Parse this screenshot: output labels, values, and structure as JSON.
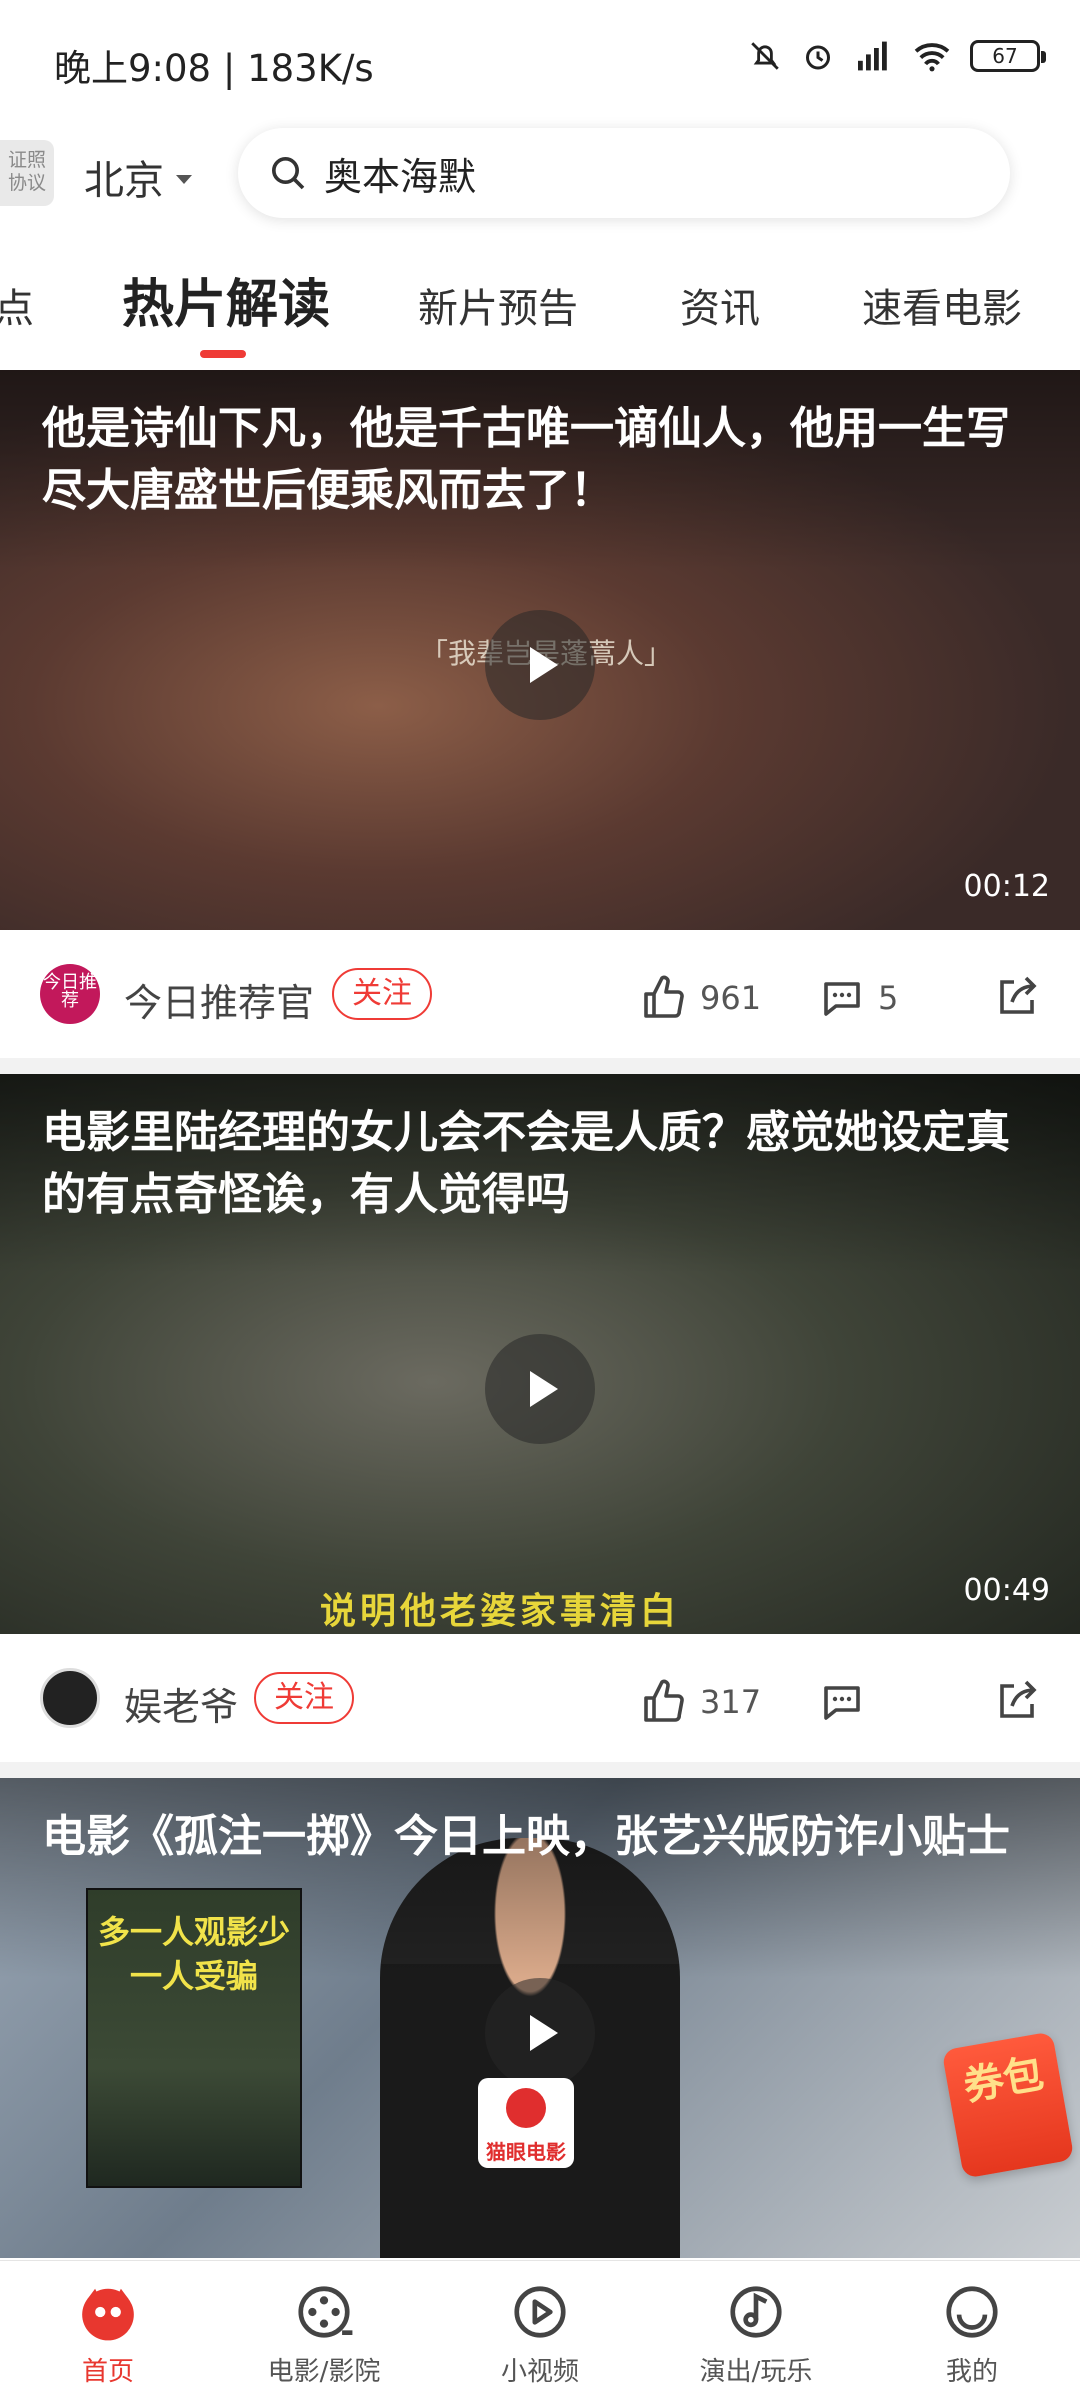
{
  "status_bar": {
    "time": "晚上9:08 | 183K/s",
    "battery": "67"
  },
  "header": {
    "license_badge": "证照协议",
    "city": "北京",
    "search_text": "奥本海默"
  },
  "tabs": [
    {
      "label": "点",
      "active": false
    },
    {
      "label": "热片解读",
      "active": true
    },
    {
      "label": "新片预告",
      "active": false
    },
    {
      "label": "资讯",
      "active": false
    },
    {
      "label": "速看电影",
      "active": false
    }
  ],
  "feed": [
    {
      "title": "他是诗仙下凡，他是千古唯一谪仙人，他用一生写尽大唐盛世后便乘风而去了！",
      "overlay_text": "「我辈岂是蓬蒿人」",
      "duration": "00:12",
      "author": "今日推荐官",
      "author_avatar_text": "今日推荐",
      "follow_label": "关注",
      "likes": "961",
      "comments": "5"
    },
    {
      "title": "电影里陆经理的女儿会不会是人质？感觉她设定真的有点奇怪诶，有人觉得吗",
      "overlay_text": "说明他老婆家事清白",
      "duration": "00:49",
      "author": "娱老爷",
      "follow_label": "关注",
      "likes": "317",
      "comments": ""
    },
    {
      "title": "电影《孤注一掷》今日上映，张艺兴版防诈小贴士",
      "poster_text": "多一人观影少一人受骗",
      "logo_text": "猫眼电影",
      "coupon_text": "券包"
    }
  ],
  "bottom_nav": [
    {
      "label": "首页",
      "active": true
    },
    {
      "label": "电影/影院",
      "active": false
    },
    {
      "label": "小视频",
      "active": false
    },
    {
      "label": "演出/玩乐",
      "active": false
    },
    {
      "label": "我的",
      "active": false
    }
  ],
  "colors": {
    "accent": "#ef3b36"
  }
}
